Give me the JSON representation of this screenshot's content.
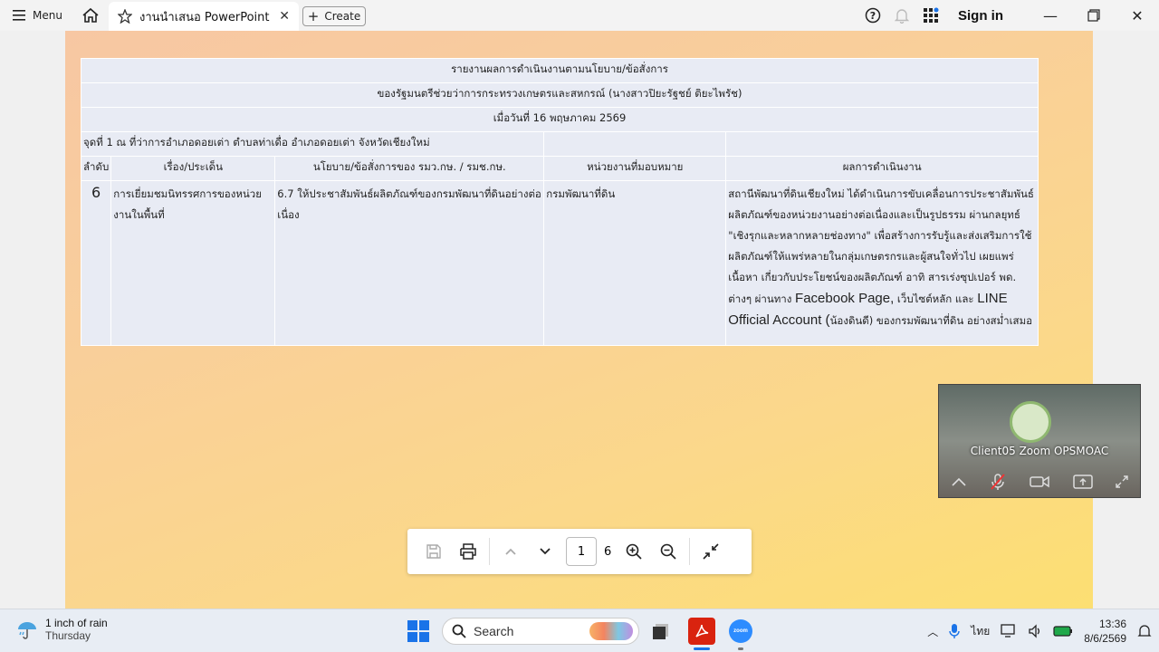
{
  "browser": {
    "menu_label": "Menu",
    "tab_title": "งานนำเสนอ PowerPoint",
    "create_label": "Create",
    "signin_label": "Sign in"
  },
  "report": {
    "title1": "รายงานผลการดำเนินงานตามนโยบาย/ข้อสั่งการ",
    "title2": "ของรัฐมนตรีช่วยว่าการกระทรวงเกษตรและสหกรณ์ (นางสาวปิยะรัฐชย์ ติยะไพรัช)",
    "title3": "เมื่อวันที่ 16 พฤษภาคม 2569",
    "location": "จุดที่ 1 ณ ที่ว่าการอำเภอดอยเต่า ตำบลท่าเดื่อ อำเภอดอยเต่า จังหวัดเชียงใหม่",
    "headers": [
      "ลำดับ",
      "เรื่อง/ประเด็น",
      "นโยบาย/ข้อสั่งการของ รมว.กษ. / รมช.กษ.",
      "หน่วยงานที่มอบหมาย",
      "ผลการดำเนินงาน"
    ],
    "row": {
      "no": "6",
      "topic": "การเยี่ยมชมนิทรรศการของหน่วยงานในพื้นที่",
      "policy": "6.7 ให้ประชาสัมพันธ์ผลิตภัณฑ์ของกรมพัฒนาที่ดินอย่างต่อเนื่อง",
      "agency": "กรมพัฒนาที่ดิน",
      "result_a": "สถานีพัฒนาที่ดินเชียงใหม่ ได้ดำเนินการขับเคลื่อนการประชาสัมพันธ์ผลิตภัณฑ์ของหน่วยงานอย่างต่อเนื่องและเป็นรูปธรรม ผ่านกลยุทธ์ \"เชิงรุกและหลากหลายช่องทาง\" เพื่อสร้างการรับรู้และส่งเสริมการใช้ผลิตภัณฑ์ให้แพร่หลายในกลุ่มเกษตรกรและผู้สนใจทั่วไป เผยแพร่เนื้อหา เกี่ยวกับประโยชน์ของผลิตภัณฑ์ อาทิ สารเร่งซุปเปอร์ พด. ต่างๆ ผ่านทาง ",
      "result_b": "Facebook Page,",
      "result_c": " เว็บไซต์หลัก และ ",
      "result_d": "LINE Official Account (",
      "result_e": "น้องดินดี) ของกรมพัฒนาที่ดิน อย่างสม่ำเสมอ"
    }
  },
  "pdf_toolbar": {
    "page_current": "1",
    "page_total": "6"
  },
  "zoom": {
    "participant": "Client05 Zoom OPSMOAC"
  },
  "taskbar": {
    "weather_line1": "1 inch of rain",
    "weather_line2": "Thursday",
    "search_label": "Search",
    "language": "ไทย",
    "time": "13:36",
    "date": "8/6/2569"
  },
  "colors": {
    "pdf_accent": "#d9230f",
    "zoom_accent": "#2d8cff",
    "windows_blue": "#1a73e8"
  }
}
